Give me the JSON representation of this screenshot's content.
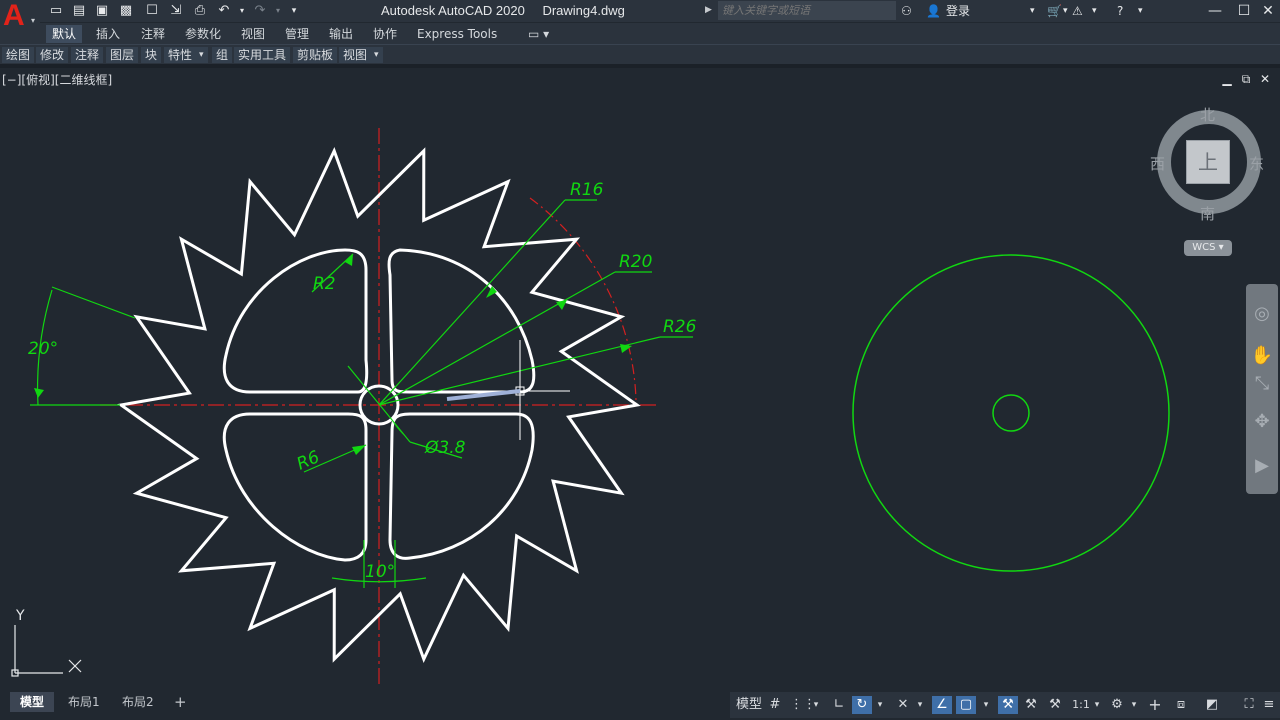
{
  "titlebar": {
    "app_name": "Autodesk AutoCAD 2020",
    "file_name": "Drawing4.dwg",
    "search_placeholder": "键入关键字或短语",
    "login": "登录"
  },
  "ribbon_tabs": [
    "默认",
    "插入",
    "注释",
    "参数化",
    "视图",
    "管理",
    "输出",
    "协作",
    "Express Tools"
  ],
  "ribbon_panels": [
    "绘图",
    "修改",
    "注释",
    "图层",
    "块",
    "特性",
    "组",
    "实用工具",
    "剪贴板",
    "视图"
  ],
  "viewport": {
    "label": "[−][俯视][二维线框]"
  },
  "viewcube": {
    "north": "北",
    "south": "南",
    "east": "东",
    "west": "西",
    "face": "上",
    "wcs": "WCS"
  },
  "ucs": {
    "x": "X",
    "y": "Y"
  },
  "dimensions": {
    "r16": "R16",
    "r20": "R20",
    "r26": "R26",
    "r2": "R2",
    "r6": "R6",
    "dia": "Ø3.8",
    "angle20": "20°",
    "angle10": "10°"
  },
  "layout_tabs": [
    "模型",
    "布局1",
    "布局2"
  ],
  "statusbar": {
    "model": "模型",
    "scale": "1:1"
  },
  "colors": {
    "background": "#212830",
    "dimension": "#00ff00",
    "centerline": "#ff0000",
    "geometry": "#ffffff"
  }
}
